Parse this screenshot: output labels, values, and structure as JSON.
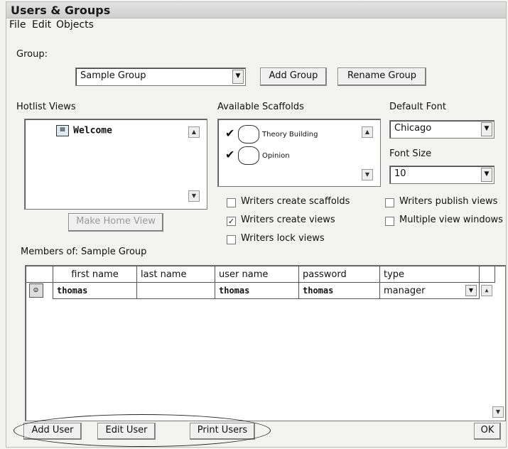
{
  "window": {
    "title": "Users & Groups"
  },
  "menu": [
    "File",
    "Edit",
    "Objects"
  ],
  "group": {
    "label": "Group:",
    "selected": "Sample Group",
    "add_button": "Add Group",
    "rename_button": "Rename Group"
  },
  "hotlist": {
    "label": "Hotlist Views",
    "items": [
      "Welcome"
    ],
    "make_home_button": "Make Home View"
  },
  "scaffolds": {
    "label": "Available Scaffolds",
    "items": [
      {
        "name": "Theory Building",
        "checked": true
      },
      {
        "name": "Opinion",
        "checked": true
      }
    ]
  },
  "font": {
    "default_label": "Default Font",
    "default_value": "Chicago",
    "size_label": "Font Size",
    "size_value": "10"
  },
  "options": [
    {
      "label": "Writers create scaffolds",
      "checked": false
    },
    {
      "label": "Writers publish views",
      "checked": false
    },
    {
      "label": "Writers create views",
      "checked": true
    },
    {
      "label": "Multiple view windows",
      "checked": false
    },
    {
      "label": "Writers lock views",
      "checked": false
    }
  ],
  "members": {
    "label_prefix": "Members of:",
    "group_name": "Sample Group",
    "columns": [
      "first name",
      "last name",
      "user name",
      "password",
      "type"
    ],
    "rows": [
      {
        "first_name": "thomas",
        "last_name": "",
        "user_name": "thomas",
        "password": "thomas",
        "type": "manager"
      }
    ]
  },
  "footer": {
    "add_user": "Add User",
    "edit_user": "Edit User",
    "print_users": "Print Users",
    "ok": "OK"
  }
}
